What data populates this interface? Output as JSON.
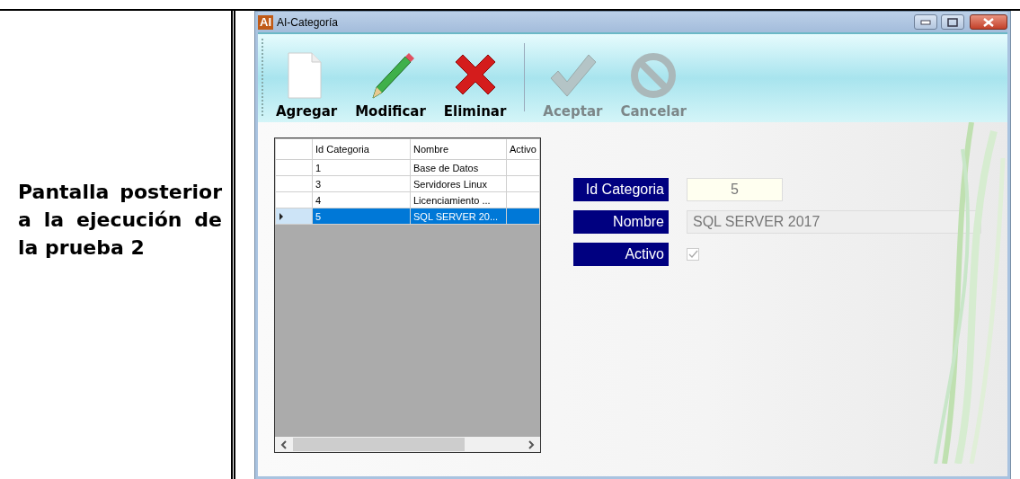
{
  "document_row": {
    "label": "Pantalla posterior a la ejecución de la prueba 2"
  },
  "window": {
    "title": "AI-Categoría",
    "app_icon_text": "AI"
  },
  "toolbar": [
    {
      "label": "Agregar",
      "kind": "new",
      "disabled": false
    },
    {
      "label": "Modificar",
      "kind": "edit",
      "disabled": false
    },
    {
      "label": "Eliminar",
      "kind": "delete",
      "disabled": false
    },
    {
      "label": "Aceptar",
      "kind": "accept",
      "disabled": true
    },
    {
      "label": "Cancelar",
      "kind": "cancel",
      "disabled": true
    }
  ],
  "grid": {
    "columns": [
      "Id Categoria",
      "Nombre",
      "Activo"
    ],
    "rows": [
      {
        "cells": [
          "1",
          "Base de Datos",
          ""
        ],
        "selected": false
      },
      {
        "cells": [
          "3",
          "Servidores Linux",
          ""
        ],
        "selected": false
      },
      {
        "cells": [
          "4",
          "Licenciamiento ...",
          ""
        ],
        "selected": false
      },
      {
        "cells": [
          "5",
          "SQL SERVER 20...",
          ""
        ],
        "selected": true
      }
    ]
  },
  "form": [
    {
      "label": "Id Categoria",
      "kind": "number",
      "value": "5"
    },
    {
      "label": "Nombre",
      "kind": "text",
      "value": "SQL SERVER 2017"
    },
    {
      "label": "Activo",
      "kind": "checkbox",
      "checked": true
    }
  ]
}
